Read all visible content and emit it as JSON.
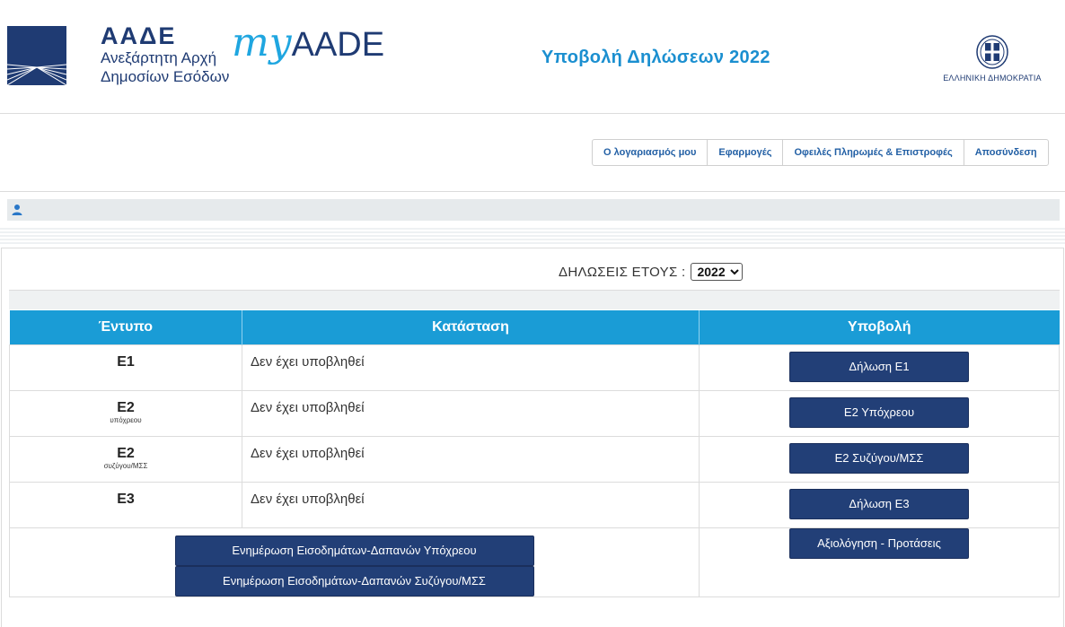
{
  "header": {
    "org_acronym": "ΑΑΔΕ",
    "org_line1": "Ανεξάρτητη Αρχή",
    "org_line2": "Δημοσίων Εσόδων",
    "brand_my": "my",
    "brand_aade": "AADE",
    "page_title": "Υποβολή Δηλώσεων 2022",
    "gov_label": "ΕΛΛΗΝΙΚΗ ΔΗΜΟΚΡΑΤΙΑ"
  },
  "nav": {
    "items": [
      {
        "label": "Ο λογαριασμός μου"
      },
      {
        "label": "Εφαρμογές"
      },
      {
        "label": "Οφειλές Πληρωμές & Επιστροφές"
      },
      {
        "label": "Αποσύνδεση"
      }
    ]
  },
  "user_bar": {
    "icon": "user-icon"
  },
  "year_filter": {
    "label": "ΔΗΛΩΣΕΙΣ ΕΤΟΥΣ :",
    "selected": "2022"
  },
  "table": {
    "headers": [
      "Έντυπο",
      "Κατάσταση",
      "Υποβολή"
    ],
    "rows": [
      {
        "form": "Ε1",
        "sub": "",
        "status": "Δεν έχει υποβληθεί",
        "button": "Δήλωση Ε1"
      },
      {
        "form": "Ε2",
        "sub": "υπόχρεου",
        "status": "Δεν έχει υποβληθεί",
        "button": "Ε2 Υπόχρεου"
      },
      {
        "form": "Ε2",
        "sub": "συζύγου/ΜΣΣ",
        "status": "Δεν έχει υποβληθεί",
        "button": "Ε2 Συζύγου/ΜΣΣ"
      },
      {
        "form": "Ε3",
        "sub": "",
        "status": "Δεν έχει υποβληθεί",
        "button": "Δήλωση Ε3"
      }
    ],
    "update_primary": "Ενημέρωση Εισοδημάτων-Δαπανών Υπόχρεου",
    "update_spouse": "Ενημέρωση Εισοδημάτων-Δαπανών Συζύγου/ΜΣΣ",
    "feedback": "Αξιολόγηση - Προτάσεις"
  },
  "colors": {
    "header_blue": "#1a9cd6",
    "button_navy": "#223f77",
    "title_blue": "#1b8fd0",
    "brand_navy": "#1f3b73"
  }
}
